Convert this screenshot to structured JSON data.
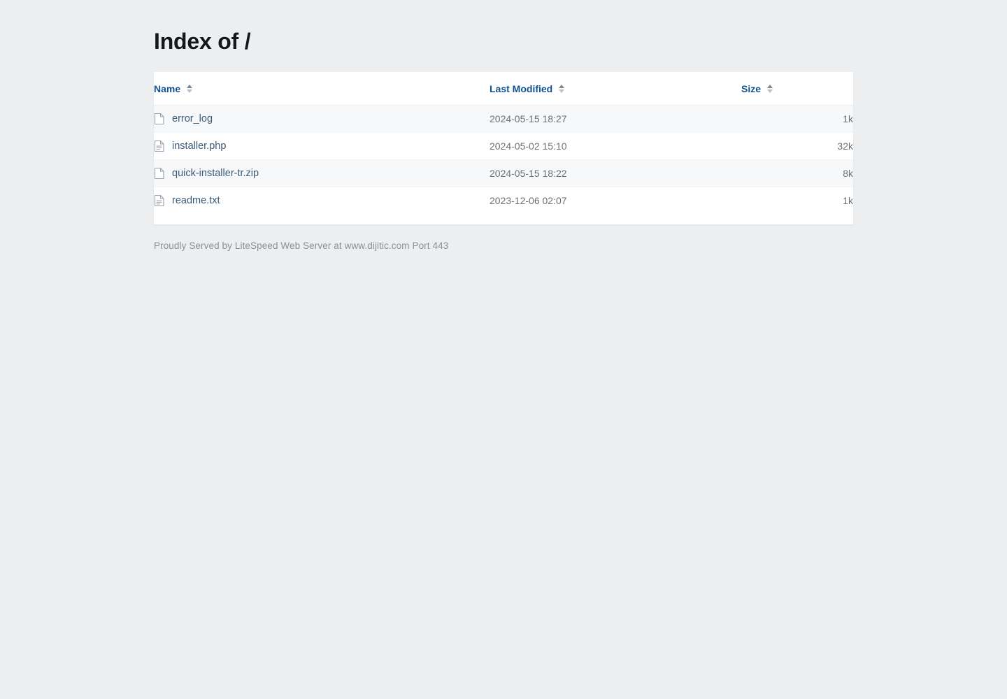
{
  "page": {
    "title": "Index of /"
  },
  "table": {
    "headers": [
      {
        "label": "Name",
        "sort_icon": "sort-icon",
        "align": "left"
      },
      {
        "label": "Last Modified",
        "sort_icon": "sort-icon",
        "align": "left"
      },
      {
        "label": "Size",
        "sort_icon": "sort-icon",
        "align": "right"
      }
    ],
    "rows": [
      {
        "icon": "file-blank-icon",
        "name": "error_log",
        "last_modified": "2024-05-15 18:27",
        "size": "1k"
      },
      {
        "icon": "file-text-lines-icon",
        "name": "installer.php",
        "last_modified": "2024-05-02 15:10",
        "size": "32k"
      },
      {
        "icon": "file-blank-icon",
        "name": "quick-installer-tr.zip",
        "last_modified": "2024-05-15 18:22",
        "size": "8k"
      },
      {
        "icon": "file-text-lines-icon",
        "name": "readme.txt",
        "last_modified": "2023-12-06 02:07",
        "size": "1k"
      }
    ]
  },
  "footer": {
    "served_by": "Proudly Served by LiteSpeed Web Server at www.dijitic.com Port 443"
  },
  "colors": {
    "page_background": "#eceef0",
    "card_background": "#ffffff",
    "row_stripe": "#f6f8fa",
    "header_text": "#12518f",
    "link_text": "#3a5a78",
    "muted_text": "#70767c",
    "title_text": "#15171a",
    "footer_text": "#8b9096"
  }
}
